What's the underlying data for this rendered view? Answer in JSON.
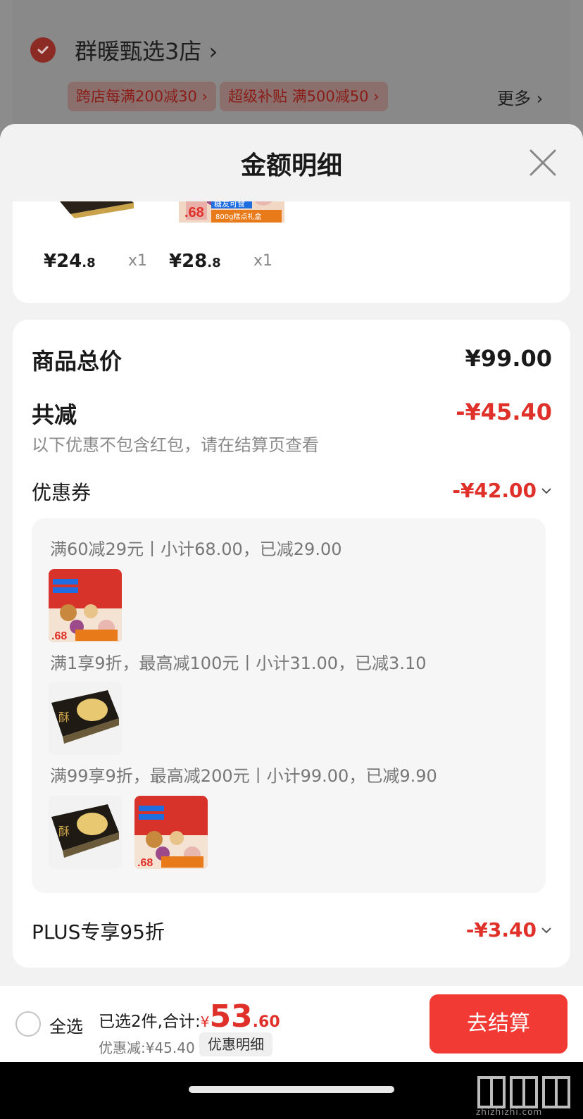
{
  "store": {
    "name": "群暖甄选3店",
    "tags": [
      "跨店每满200减30",
      "超级补贴  满500减50"
    ],
    "more": "更多"
  },
  "sheet": {
    "title": "金额明细",
    "products": [
      {
        "price_int": "¥24",
        "price_dec": ".8",
        "qty": "x1"
      },
      {
        "price_int": "¥28",
        "price_dec": ".8",
        "qty": "x1"
      }
    ],
    "goods_total_label": "商品总价",
    "goods_total_value": "¥99.00",
    "total_reduce_label": "共减",
    "total_reduce_value": "-¥45.40",
    "reduce_note": "以下优惠不包含红包，请在结算页查看",
    "coupon_label": "优惠券",
    "coupon_value": "-¥42.00",
    "coupon_rules": [
      "满60减29元丨小计68.00，已减29.00",
      "满1享9折，最高减100元丨小计31.00，已减3.10",
      "满99享9折，最高减200元丨小计99.00，已减9.90"
    ],
    "plus_label": "PLUS专享95折",
    "plus_value": "-¥3.40",
    "thumb_badge": ".68",
    "thumb_caption": "糖友可食",
    "thumb_subcaption": "800g糕点礼盒"
  },
  "bottom": {
    "select_all": "全选",
    "summary_prefix": "已选2件,合计:",
    "yen": "¥",
    "total_int": "53",
    "total_dec": ".60",
    "discount": "优惠减:¥45.40",
    "detail_chip": "优惠明细",
    "checkout": "去结算"
  },
  "watermark": "zhizhizhi.com",
  "colors": {
    "accent": "#f23a35",
    "red_text": "#e0302a"
  }
}
